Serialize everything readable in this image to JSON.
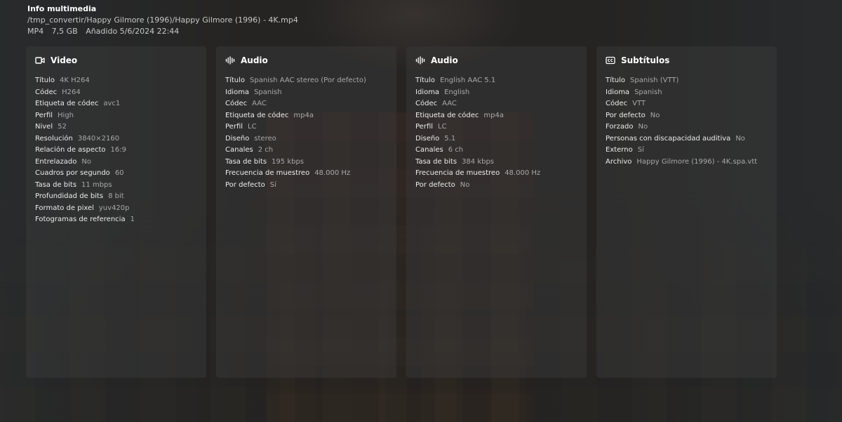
{
  "header": {
    "title": "Info multimedia",
    "path": "/tmp_convertir/Happy Gilmore (1996)/Happy Gilmore (1996) - 4K.mp4",
    "format": "MP4",
    "size": "7,5 GB",
    "added": "Añadido 5/6/2024 22:44"
  },
  "panels": [
    {
      "title": "Video",
      "icon": "video-camera-icon",
      "rows": [
        {
          "k": "Título",
          "v": "4K H264"
        },
        {
          "k": "Códec",
          "v": "H264"
        },
        {
          "k": "Etiqueta de códec",
          "v": "avc1"
        },
        {
          "k": "Perfil",
          "v": "High"
        },
        {
          "k": "Nivel",
          "v": "52"
        },
        {
          "k": "Resolución",
          "v": "3840×2160"
        },
        {
          "k": "Relación de aspecto",
          "v": "16:9"
        },
        {
          "k": "Entrelazado",
          "v": "No"
        },
        {
          "k": "Cuadros por segundo",
          "v": "60"
        },
        {
          "k": "Tasa de bits",
          "v": "11 mbps"
        },
        {
          "k": "Profundidad de bits",
          "v": "8 bit"
        },
        {
          "k": "Formato de pixel",
          "v": "yuv420p"
        },
        {
          "k": "Fotogramas de referencia",
          "v": "1"
        }
      ]
    },
    {
      "title": "Audio",
      "icon": "audio-waveform-icon",
      "rows": [
        {
          "k": "Título",
          "v": "Spanish AAC stereo (Por defecto)"
        },
        {
          "k": "Idioma",
          "v": "Spanish"
        },
        {
          "k": "Códec",
          "v": "AAC"
        },
        {
          "k": "Etiqueta de códec",
          "v": "mp4a"
        },
        {
          "k": "Perfil",
          "v": "LC"
        },
        {
          "k": "Diseño",
          "v": "stereo"
        },
        {
          "k": "Canales",
          "v": "2 ch"
        },
        {
          "k": "Tasa de bits",
          "v": "195 kbps"
        },
        {
          "k": "Frecuencia de muestreo",
          "v": "48.000 Hz"
        },
        {
          "k": "Por defecto",
          "v": "Sí"
        }
      ]
    },
    {
      "title": "Audio",
      "icon": "audio-waveform-icon",
      "rows": [
        {
          "k": "Título",
          "v": "English AAC 5.1"
        },
        {
          "k": "Idioma",
          "v": "English"
        },
        {
          "k": "Códec",
          "v": "AAC"
        },
        {
          "k": "Etiqueta de códec",
          "v": "mp4a"
        },
        {
          "k": "Perfil",
          "v": "LC"
        },
        {
          "k": "Diseño",
          "v": "5.1"
        },
        {
          "k": "Canales",
          "v": "6 ch"
        },
        {
          "k": "Tasa de bits",
          "v": "384 kbps"
        },
        {
          "k": "Frecuencia de muestreo",
          "v": "48.000 Hz"
        },
        {
          "k": "Por defecto",
          "v": "No"
        }
      ]
    },
    {
      "title": "Subtítulos",
      "icon": "closed-captions-icon",
      "rows": [
        {
          "k": "Título",
          "v": "Spanish (VTT)"
        },
        {
          "k": "Idioma",
          "v": "Spanish"
        },
        {
          "k": "Códec",
          "v": "VTT"
        },
        {
          "k": "Por defecto",
          "v": "No"
        },
        {
          "k": "Forzado",
          "v": "No"
        },
        {
          "k": "Personas con discapacidad auditiva",
          "v": "No"
        },
        {
          "k": "Externo",
          "v": "Sí"
        },
        {
          "k": "Archivo",
          "v": "Happy Gilmore (1996) - 4K.spa.vtt"
        }
      ]
    }
  ]
}
